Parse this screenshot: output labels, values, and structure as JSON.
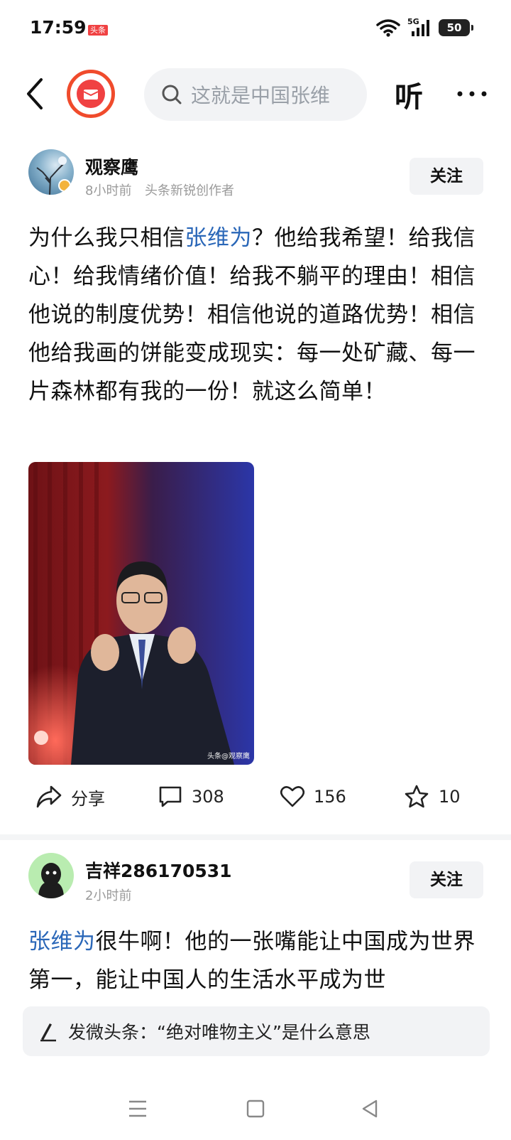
{
  "status_bar": {
    "time": "17:59",
    "app_badge": "头条",
    "network": "5G",
    "battery": "50"
  },
  "header": {
    "search_placeholder": "这就是中国张维",
    "listen_label": "听"
  },
  "post1": {
    "author": "观察鹰",
    "time": "8小时前",
    "tag": "头条新锐创作者",
    "follow_label": "关注",
    "text_pre": "为什么我只相信",
    "text_link": "张维为",
    "text_post": "？他给我希望！给我信心！给我情绪价值！给我不躺平的理由！相信他说的制度优势！相信他说的道路优势！相信他给我画的饼能变成现实：每一处矿藏、每一片森林都有我的一份！就这么简单！",
    "photo_caption": "头条@观察鹰",
    "actions": {
      "share_label": "分享",
      "comments": "308",
      "likes": "156",
      "favorites": "10"
    }
  },
  "post2": {
    "author": "吉祥286170531",
    "time": "2小时前",
    "follow_label": "关注",
    "text_link": "张维为",
    "text_post": "很牛啊！他的一张嘴能让中国成为世界第一，能让中国人的生活水平成为世"
  },
  "publish_bar": {
    "text": "发微头条：“绝对唯物主义”是什么意思"
  },
  "colors": {
    "link": "#2a67b8",
    "brand_red": "#f04142"
  }
}
